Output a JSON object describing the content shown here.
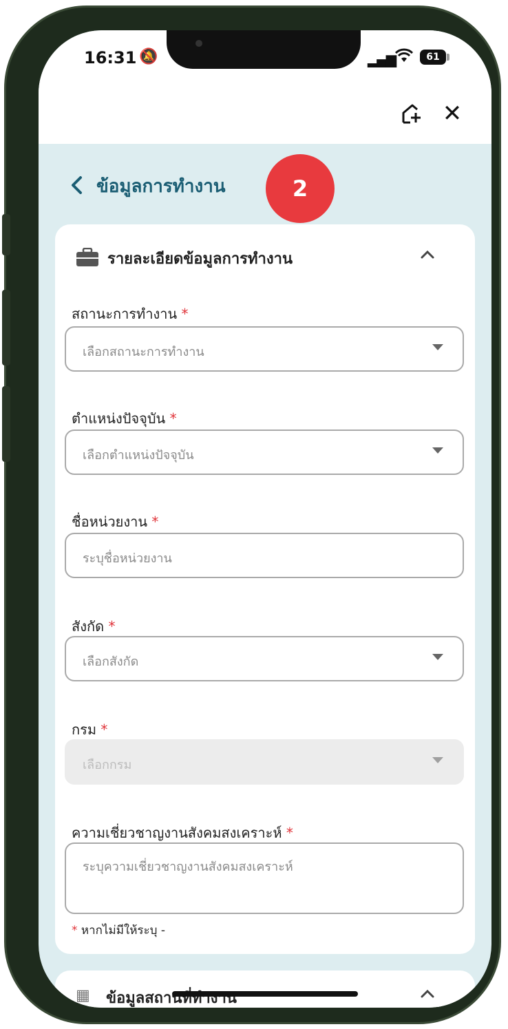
{
  "status": {
    "time": "16:31",
    "battery": "61"
  },
  "icons": {
    "bell_muted": "bell-slash-icon",
    "wifi": "wifi-icon",
    "signal": "signal-icon",
    "add_to_home": "add-to-home-icon",
    "close": "close-icon",
    "back": "chevron-left-icon",
    "briefcase": "briefcase-icon",
    "chevron_up": "chevron-up-icon",
    "caret_down": "caret-down-icon",
    "building": "building-icon"
  },
  "header": {
    "back_symbol": "‹",
    "title": "ข้อมูลการทำงาน",
    "step_badge": "2"
  },
  "colors": {
    "accent": "#1a5d73",
    "badge": "#e83a3e",
    "required": "#e0343a",
    "background": "#ddedf0"
  },
  "card": {
    "title": "รายละเอียดข้อมูลการทำงาน",
    "required_mark": "*",
    "fields": [
      {
        "label": "สถานะการทำงาน",
        "placeholder": "เลือกสถานะการทำงาน",
        "type": "select",
        "disabled": false
      },
      {
        "label": "ตำแหน่งปัจจุบัน",
        "placeholder": "เลือกตำแหน่งปัจจุบัน",
        "type": "select",
        "disabled": false
      },
      {
        "label": "ชื่อหน่วยงาน",
        "placeholder": "ระบุชื่อหน่วยงาน",
        "type": "text",
        "disabled": false
      },
      {
        "label": "สังกัด",
        "placeholder": "เลือกสังกัด",
        "type": "select",
        "disabled": false
      },
      {
        "label": "กรม",
        "placeholder": "เลือกกรม",
        "type": "select",
        "disabled": true
      },
      {
        "label": "ความเชี่ยวชาญงานสังคมสงเคราะห์",
        "placeholder": "ระบุความเชี่ยวชาญงานสังคมสงเคราะห์",
        "type": "textarea",
        "disabled": false
      }
    ],
    "note": "หากไม่มีให้ระบุ -"
  },
  "next_card": {
    "title": "ข้อมูลสถานที่ทำงาน"
  }
}
